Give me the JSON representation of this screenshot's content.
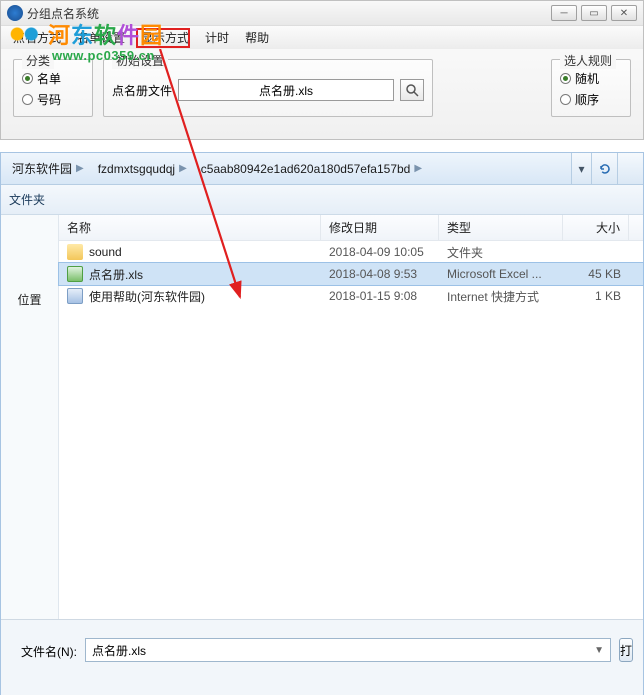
{
  "top": {
    "title": "分组点名系统",
    "menu": [
      "点名方式",
      "名单设置",
      "显示方式",
      "计时",
      "帮助"
    ],
    "groups": {
      "classify": {
        "legend": "分类",
        "opt1": "名单",
        "opt2": "号码"
      },
      "initial": {
        "legend": "初始设置",
        "label": "点名册文件",
        "value": "点名册.xls"
      },
      "rule": {
        "legend": "选人规则",
        "opt1": "随机",
        "opt2": "顺序"
      }
    }
  },
  "watermark": {
    "cn": [
      "河",
      "东",
      "软",
      "件",
      "园"
    ],
    "url": "www.pc0359.cn"
  },
  "dialog": {
    "crumbs": [
      "河东软件园",
      "fzdmxtsgqudqj",
      "c5aab80942e1ad620a180d57efa157bd"
    ],
    "toolbar": "文件夹",
    "sidebar": {
      "item": "位置"
    },
    "columns": {
      "name": "名称",
      "date": "修改日期",
      "type": "类型",
      "size": "大小"
    },
    "rows": [
      {
        "icon": "folder",
        "name": "sound",
        "date": "2018-04-09 10:05",
        "type": "文件夹",
        "size": ""
      },
      {
        "icon": "xls",
        "name": "点名册.xls",
        "date": "2018-04-08 9:53",
        "type": "Microsoft Excel ...",
        "size": "45 KB",
        "selected": true
      },
      {
        "icon": "url",
        "name": "使用帮助(河东软件园)",
        "date": "2018-01-15 9:08",
        "type": "Internet 快捷方式",
        "size": "1 KB"
      }
    ],
    "footer": {
      "label": "文件名(N):",
      "value": "点名册.xls",
      "open_prefix": "打"
    }
  }
}
